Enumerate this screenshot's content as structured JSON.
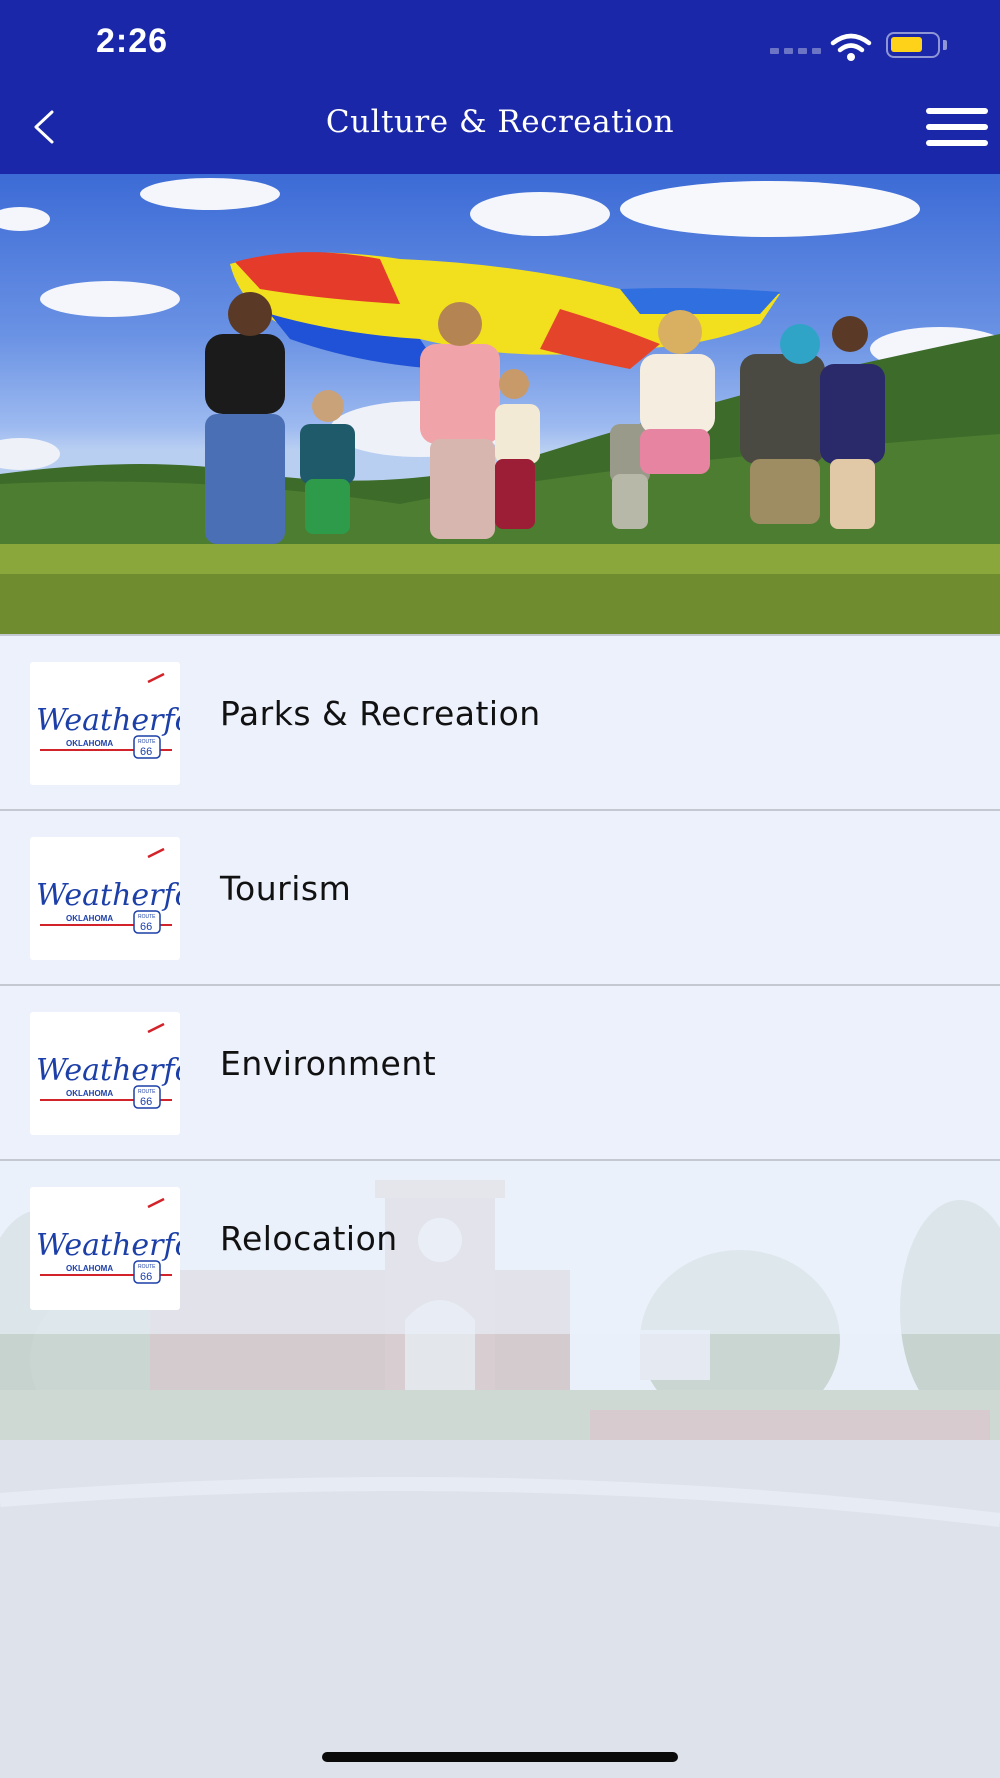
{
  "status_bar": {
    "time": "2:26"
  },
  "nav": {
    "title": "Culture & Recreation",
    "back_icon": "chevron-left-icon",
    "menu_icon": "hamburger-menu-icon"
  },
  "hero": {
    "image": "children-with-parachute-photo"
  },
  "logo": {
    "script_text": "Weatherford",
    "state_text": "OKLAHOMA",
    "shield_top": "ROUTE",
    "shield_number": "66"
  },
  "items": [
    {
      "label": "Parks & Recreation"
    },
    {
      "label": "Tourism"
    },
    {
      "label": "Environment"
    },
    {
      "label": "Relocation"
    }
  ],
  "colors": {
    "header": "#1a27a8",
    "list_background": "#eaf0fa",
    "logo_blue": "#1c3fa8",
    "logo_red": "#d2232a"
  }
}
